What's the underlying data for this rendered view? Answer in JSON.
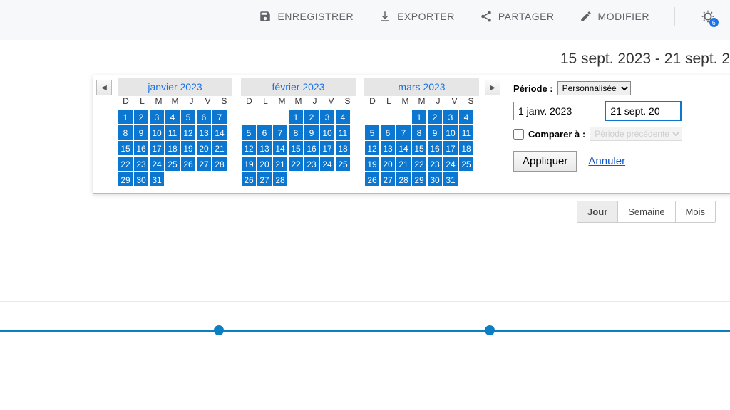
{
  "topbar": {
    "save": "ENREGISTRER",
    "export": "EXPORTER",
    "share": "PARTAGER",
    "edit": "MODIFIER",
    "badge": "6"
  },
  "date_range_display": "15 sept. 2023 - 21 sept. 2",
  "dow": [
    "D",
    "L",
    "M",
    "M",
    "J",
    "V",
    "S"
  ],
  "months": [
    {
      "title": "janvier 2023",
      "start_dow": 0,
      "days": 31,
      "sel": {
        "from": 1,
        "to": 31
      }
    },
    {
      "title": "février 2023",
      "start_dow": 3,
      "days": 28,
      "sel": {
        "from": 1,
        "to": 28
      }
    },
    {
      "title": "mars 2023",
      "start_dow": 3,
      "days": 31,
      "sel": {
        "from": 1,
        "to": 31
      }
    }
  ],
  "controls": {
    "period_label": "Période :",
    "period_value": "Personnalisée",
    "start_date": "1 janv. 2023",
    "end_date": "21 sept. 20",
    "compare_label": "Comparer à :",
    "compare_value": "Période précédente",
    "apply": "Appliquer",
    "cancel": "Annuler"
  },
  "granularity": {
    "day": "Jour",
    "week": "Semaine",
    "month": "Mois"
  },
  "chart_data": {
    "type": "line",
    "x": [
      0,
      1,
      2
    ],
    "values": [
      0,
      0,
      0
    ],
    "title": "",
    "xlabel": "",
    "ylabel": "",
    "ylim": [
      0,
      1
    ]
  }
}
